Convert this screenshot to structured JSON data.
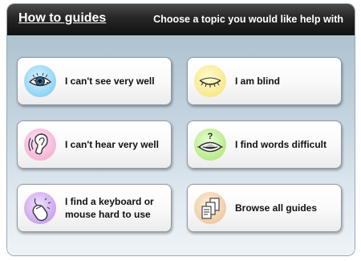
{
  "header": {
    "title": "How to guides",
    "subtitle": "Choose a topic you would like help with"
  },
  "guides": [
    {
      "label": "I can't see very well",
      "icon": "eye-icon",
      "color": "#8fd4f6"
    },
    {
      "label": "I am blind",
      "icon": "closed-eye-icon",
      "color": "#f7e98c"
    },
    {
      "label": "I can't hear very well",
      "icon": "ear-icon",
      "color": "#f5b5d6"
    },
    {
      "label": "I find words difficult",
      "icon": "mouth-question-icon",
      "color": "#b8ea8a"
    },
    {
      "label": "I find a keyboard or mouse hard to use",
      "icon": "mouse-icon",
      "color": "#cca5ef"
    },
    {
      "label": "Browse all guides",
      "icon": "documents-icon",
      "color": "#efcca5"
    }
  ]
}
